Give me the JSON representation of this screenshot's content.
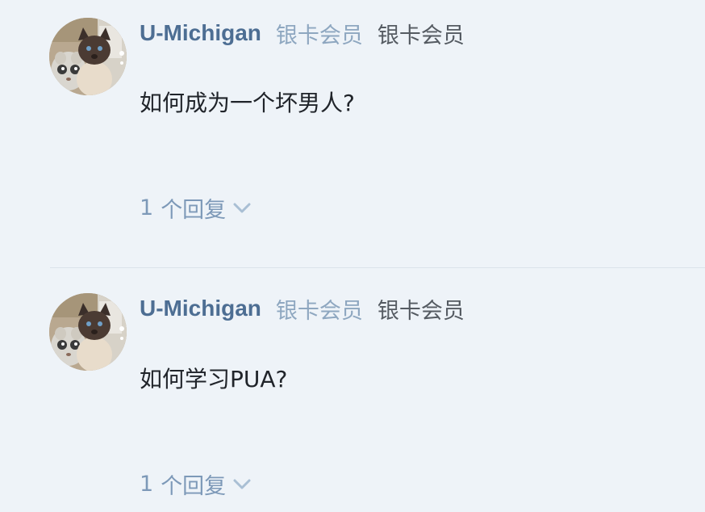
{
  "comments": [
    {
      "username": "U-Michigan",
      "badge": "银卡会员",
      "badge_secondary": "银卡会员",
      "text": "如何成为一个坏男人?",
      "reply_count": "1",
      "reply_label": "个回复"
    },
    {
      "username": "U-Michigan",
      "badge": "银卡会员",
      "badge_secondary": "银卡会员",
      "text": "如何学习PUA?",
      "reply_count": "1",
      "reply_label": "个回复"
    }
  ],
  "colors": {
    "background": "#eef3f8",
    "username": "#4d6e93",
    "badge": "#8ea7c0",
    "badge_secondary": "#555b62",
    "text": "#20242a",
    "reply": "#7d99b8"
  },
  "icons": {
    "avatar": "cat-avatar-image",
    "expand": "chevron-down-icon"
  }
}
